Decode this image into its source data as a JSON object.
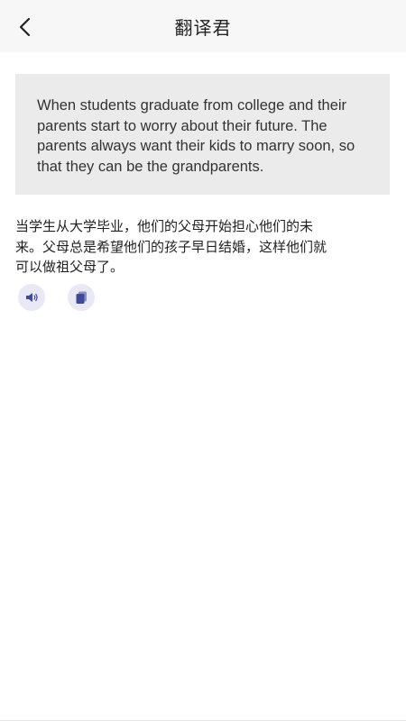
{
  "header": {
    "title": "翻译君",
    "back_icon": "chevron-left-icon"
  },
  "source": {
    "text": "When students graduate from college and their parents start to worry about their future. The parents always want their kids to marry soon, so that they can be the grandparents."
  },
  "translation": {
    "text": "当学生从大学毕业，他们的父母开始担心他们的未来。父母总是希望他们的孩子早日结婚，这样他们就可以做祖父母了。"
  },
  "actions": {
    "speaker_icon": "speaker-icon",
    "copy_icon": "copy-icon"
  },
  "colors": {
    "accent": "#3f4a9a",
    "icon_bg": "#e8e9f5",
    "source_bg": "#ebebeb",
    "header_bg": "#f7f7f7"
  }
}
